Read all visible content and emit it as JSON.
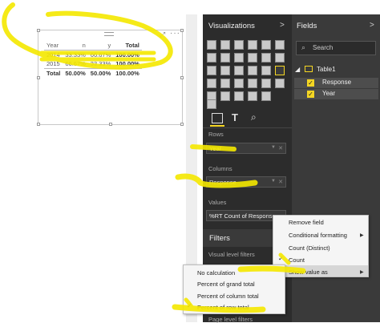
{
  "matrix": {
    "headers": [
      "Year",
      "n",
      "y",
      "Total"
    ],
    "rows": [
      [
        "2014",
        "33.33%",
        "66.67%",
        "100.00%"
      ],
      [
        "2015",
        "66.67%",
        "33.33%",
        "100.00%"
      ],
      [
        "Total",
        "50.00%",
        "50.00%",
        "100.00%"
      ]
    ]
  },
  "visualizations": {
    "title": "Visualizations",
    "rows_label": "Rows",
    "rows_value": "Year",
    "columns_label": "Columns",
    "columns_value": "Response",
    "values_label": "Values",
    "values_value": "%RT Count of Response"
  },
  "filters": {
    "title": "Filters",
    "visual_level": "Visual level filters",
    "page_level": "Page level filters"
  },
  "fields": {
    "title": "Fields",
    "search_placeholder": "Search",
    "table": "Table1",
    "items": [
      "Response",
      "Year"
    ]
  },
  "context_menu": {
    "items": [
      "Remove field",
      "Conditional formatting",
      "Count (Distinct)",
      "Count",
      "Show value as"
    ]
  },
  "submenu": {
    "items": [
      "No calculation",
      "Percent of grand total",
      "Percent of column total",
      "Percent of row total"
    ]
  },
  "colors": {
    "highlight": "#f5e800",
    "accent": "#f5d623"
  }
}
